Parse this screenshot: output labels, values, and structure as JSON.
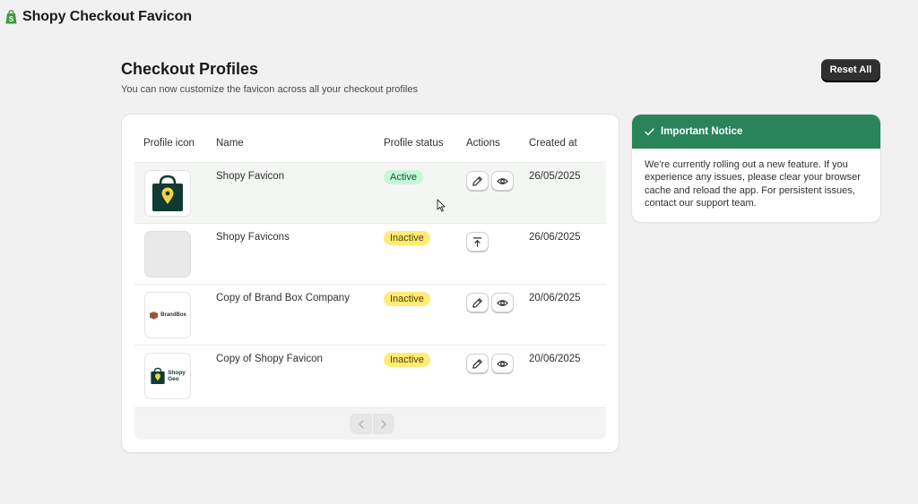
{
  "app": {
    "title": "Shopy Checkout Favicon",
    "logo_icon": "shopify-bag-icon",
    "logo_color": "#3f9b3f"
  },
  "page": {
    "title": "Checkout Profiles",
    "subtitle": "You can now customize the favicon across all your checkout profiles",
    "reset_label": "Reset All"
  },
  "table": {
    "headers": {
      "icon": "Profile icon",
      "name": "Name",
      "status": "Profile status",
      "actions": "Actions",
      "created": "Created at"
    },
    "rows": [
      {
        "thumb": "green-map-pin-bag-icon",
        "name": "Shopy Favicon",
        "status": "Active",
        "actions": [
          "edit-icon",
          "view-icon"
        ],
        "created": "26/05/2025"
      },
      {
        "thumb": "empty-placeholder",
        "name": "Shopy Favicons",
        "status": "Inactive",
        "actions": [
          "upload-icon"
        ],
        "created": "26/06/2025"
      },
      {
        "thumb": "brandbox-logo",
        "name": "Copy of Brand Box Company",
        "status": "Inactive",
        "actions": [
          "edit-icon",
          "view-icon"
        ],
        "created": "20/06/2025"
      },
      {
        "thumb": "shopy-geo-logo",
        "name": "Copy of Shopy Favicon",
        "status": "Inactive",
        "actions": [
          "edit-icon",
          "view-icon"
        ],
        "created": "20/06/2025"
      }
    ],
    "logo_texts": {
      "brandbox": "BrandBox",
      "shopygeo_line1": "Shopy",
      "shopygeo_line2": "Geo"
    },
    "pagination": {
      "prev_icon": "chevron-left-icon",
      "next_icon": "chevron-right-icon"
    }
  },
  "notice": {
    "icon": "checkmark-icon",
    "title": "Important Notice",
    "body": "We're currently rolling out a new feature. If you experience any issues, please clear your browser cache and reload the app. For persistent issues, contact our support team.",
    "header_color": "#29845a"
  },
  "colors": {
    "active_badge": "#c8f7d8",
    "inactive_badge": "#ffeb78",
    "primary_button": "#2f2f2f",
    "pin_yellow": "#f5d442",
    "bag_dark": "#0f3b33"
  }
}
